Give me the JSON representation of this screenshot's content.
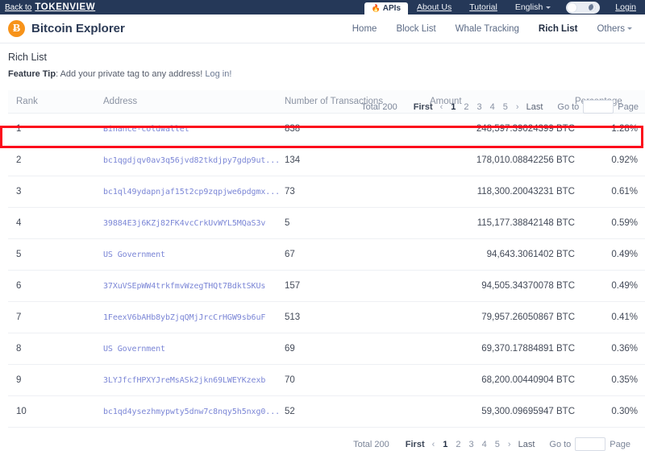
{
  "topbar": {
    "back_prefix": "Back to",
    "brand": "TOKENVIEW",
    "apis_label": "APIs",
    "flame_icon": "flame-icon",
    "about_label": "About Us",
    "tutorial_label": "Tutorial",
    "language_label": "English",
    "login_label": "Login"
  },
  "header": {
    "logo_glyph": "Ƀ",
    "title": "Bitcoin Explorer",
    "nav": [
      {
        "label": "Home",
        "active": false
      },
      {
        "label": "Block List",
        "active": false
      },
      {
        "label": "Whale Tracking",
        "active": false
      },
      {
        "label": "Rich List",
        "active": true
      },
      {
        "label": "Others",
        "active": false,
        "has_caret": true
      }
    ]
  },
  "page": {
    "section_title": "Rich List",
    "tip_label": "Feature Tip",
    "tip_text": ": Add your private tag to any address!",
    "tip_link": "Log in!"
  },
  "pagination": {
    "total_label": "Total 200",
    "first_label": "First",
    "prev_arrow": "‹",
    "next_arrow": "›",
    "pages": [
      "1",
      "2",
      "3",
      "4",
      "5"
    ],
    "current_page": "1",
    "last_label": "Last",
    "goto_label": "Go to",
    "goto_value": "",
    "page_label": "Page"
  },
  "table": {
    "columns": [
      {
        "key": "rank",
        "label": "Rank"
      },
      {
        "key": "address",
        "label": "Address"
      },
      {
        "key": "txn",
        "label": "Number of Transactions"
      },
      {
        "key": "amount",
        "label": "Amount"
      },
      {
        "key": "percentage",
        "label": "Percentage"
      }
    ],
    "rows": [
      {
        "rank": "1",
        "address": "Binance-coldwallet",
        "txn": "838",
        "amount": "248,597.39024399 BTC",
        "percentage": "1.28%"
      },
      {
        "rank": "2",
        "address": "bc1qgdjqv0av3q56jvd82tkdjpy7gdp9ut...",
        "txn": "134",
        "amount": "178,010.08842256 BTC",
        "percentage": "0.92%"
      },
      {
        "rank": "3",
        "address": "bc1ql49ydapnjaf15t2cp9zqpjwe6pdgmx...",
        "txn": "73",
        "amount": "118,300.20043231 BTC",
        "percentage": "0.61%"
      },
      {
        "rank": "4",
        "address": "39884E3j6KZj82FK4vcCrkUvWYL5MQaS3v",
        "txn": "5",
        "amount": "115,177.38842148 BTC",
        "percentage": "0.59%"
      },
      {
        "rank": "5",
        "address": "US Government",
        "txn": "67",
        "amount": "94,643.3061402 BTC",
        "percentage": "0.49%"
      },
      {
        "rank": "6",
        "address": "37XuVSEpWW4trkfmvWzegTHQt7BdktSKUs",
        "txn": "157",
        "amount": "94,505.34370078 BTC",
        "percentage": "0.49%"
      },
      {
        "rank": "7",
        "address": "1FeexV6bAHb8ybZjqQMjJrcCrHGW9sb6uF",
        "txn": "513",
        "amount": "79,957.26050867 BTC",
        "percentage": "0.41%"
      },
      {
        "rank": "8",
        "address": "US Government",
        "txn": "69",
        "amount": "69,370.17884891 BTC",
        "percentage": "0.36%"
      },
      {
        "rank": "9",
        "address": "3LYJfcfHPXYJreMsASk2jkn69LWEYKzexb",
        "txn": "70",
        "amount": "68,200.00440904 BTC",
        "percentage": "0.35%"
      },
      {
        "rank": "10",
        "address": "bc1qd4ysezhmypwty5dnw7c8nqy5h5nxg0...",
        "txn": "52",
        "amount": "59,300.09695947 BTC",
        "percentage": "0.30%"
      }
    ]
  },
  "annotation": {
    "highlight_color": "#fc0d1c",
    "target": "table-header-row"
  },
  "colors": {
    "topbar_bg": "#253858",
    "brand_orange": "#f7931a",
    "link_blue": "#7b86d6"
  }
}
